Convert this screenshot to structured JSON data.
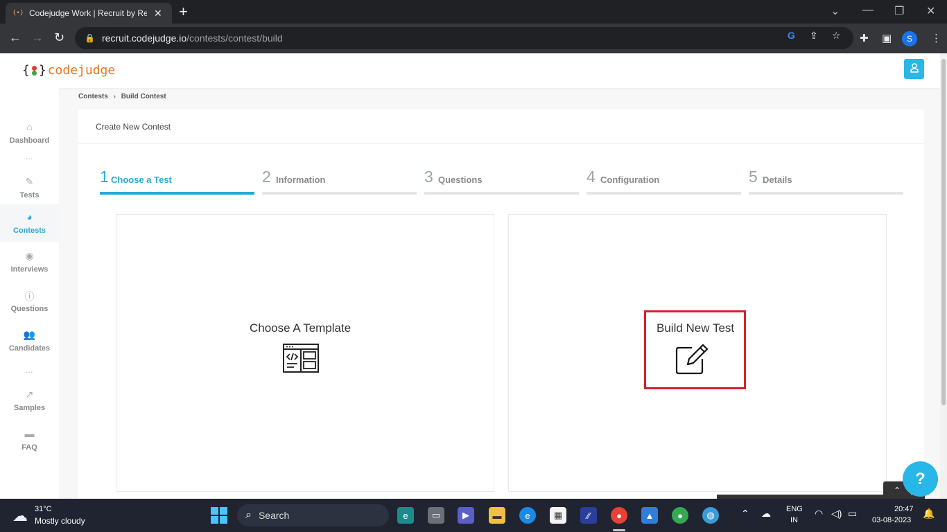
{
  "browser": {
    "tab_title": "Codejudge Work | Recruit by Real",
    "tab_favicon": "{•}",
    "url_host": "recruit.codejudge.io",
    "url_path": "/contests/contest/build",
    "profile_initial": "S"
  },
  "app": {
    "logo_left": "{",
    "logo_right": "}",
    "logo_name": "codejudge",
    "accent_color": "#29a8d6",
    "brand_color": "#e87722"
  },
  "sidebar": {
    "items": [
      {
        "label": "Dashboard",
        "icon": "home-icon"
      },
      {
        "label": "Tests",
        "icon": "pencil-icon"
      },
      {
        "label": "Contests",
        "icon": "pie-chart-icon",
        "active": true
      },
      {
        "label": "Interviews",
        "icon": "podcast-icon"
      },
      {
        "label": "Questions",
        "icon": "question-circle-icon"
      },
      {
        "label": "Candidates",
        "icon": "users-icon"
      },
      {
        "label": "Samples",
        "icon": "line-chart-icon"
      },
      {
        "label": "FAQ",
        "icon": "comments-icon"
      }
    ],
    "separator": "…"
  },
  "breadcrumb": {
    "items": [
      "Contests",
      "Build Contest"
    ],
    "separator": "›"
  },
  "card": {
    "title": "Create New Contest"
  },
  "steps": [
    {
      "num": "1",
      "label": "Choose a Test",
      "active": true
    },
    {
      "num": "2",
      "label": "Information"
    },
    {
      "num": "3",
      "label": "Questions"
    },
    {
      "num": "4",
      "label": "Configuration"
    },
    {
      "num": "5",
      "label": "Details"
    }
  ],
  "options": {
    "template": {
      "label": "Choose A Template",
      "icon": "code-template-icon"
    },
    "build": {
      "label": "Build New Test",
      "icon": "edit-icon"
    }
  },
  "help_button": "?",
  "scroll_top_button": "⌃",
  "taskbar": {
    "weather_temp": "31°C",
    "weather_desc": "Mostly cloudy",
    "search_label": "Search",
    "lang_line1": "ENG",
    "lang_line2": "IN",
    "time": "20:47",
    "date": "03-08-2023"
  }
}
